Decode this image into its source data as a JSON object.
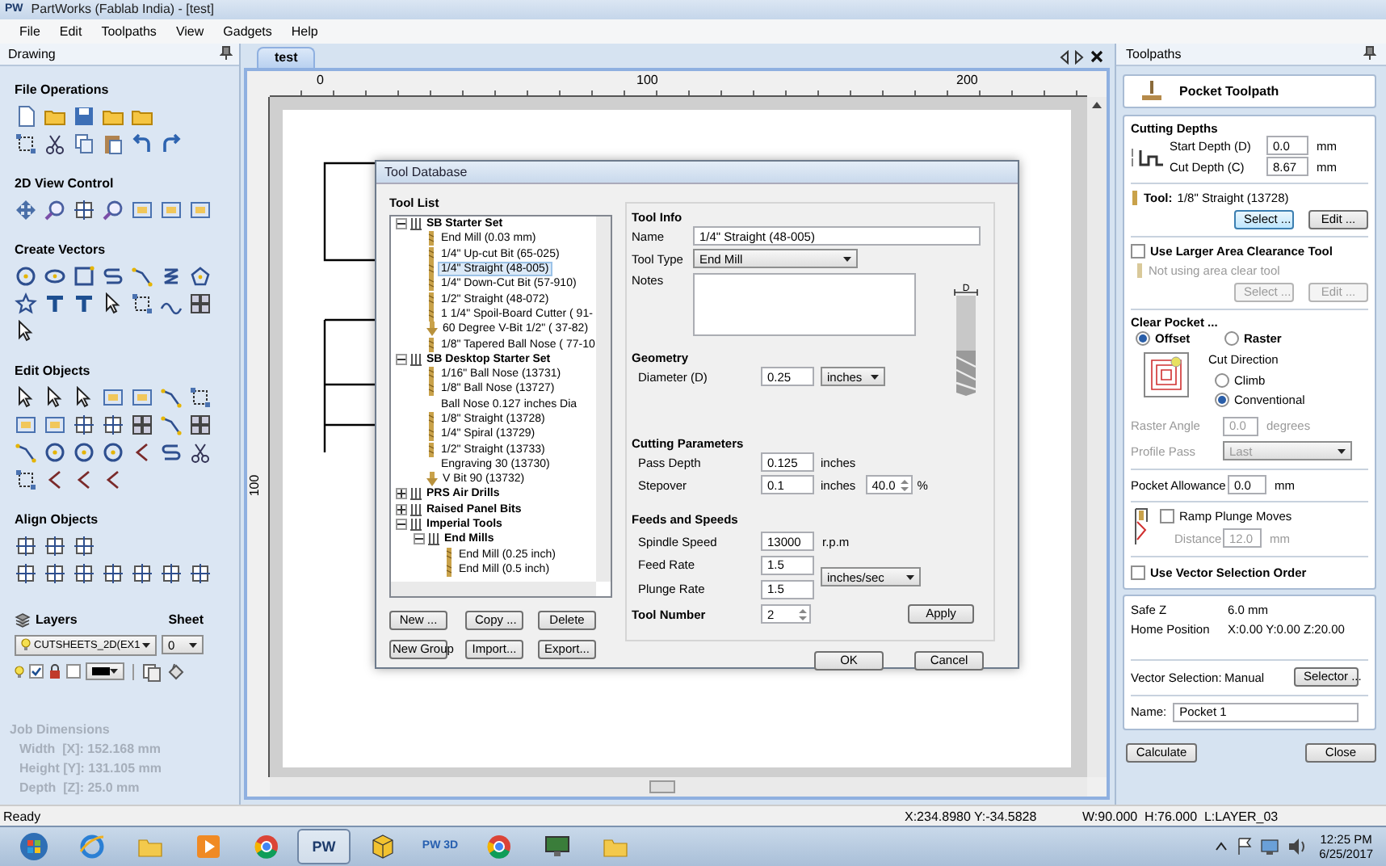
{
  "window": {
    "app_icon": "PW",
    "title": "PartWorks (Fablab India) - [test]"
  },
  "menu": [
    "File",
    "Edit",
    "Toolpaths",
    "View",
    "Gadgets",
    "Help"
  ],
  "drawing_panel": {
    "title": "Drawing",
    "sections": [
      {
        "title": "File Operations"
      },
      {
        "title": "2D View Control"
      },
      {
        "title": "Create Vectors"
      },
      {
        "title": "Edit Objects"
      },
      {
        "title": "Align Objects"
      }
    ],
    "layers": {
      "title": "Layers",
      "sheet_label": "Sheet",
      "layer": "CUTSHEETS_2D(EX1",
      "sheet": "0",
      "visible_checked": true,
      "locked_checked": false
    },
    "job_dimensions": {
      "title": "Job Dimensions",
      "lines": [
        "Width  [X]: 152.168 mm",
        "Height [Y]: 131.105 mm",
        "Depth  [Z]: 25.0 mm"
      ]
    }
  },
  "document_tab": {
    "label": "test",
    "selected": true
  },
  "ruler": {
    "top_ticks": [
      "0",
      "100",
      "200"
    ],
    "left_ticks": [
      "100"
    ]
  },
  "tool_database": {
    "title": "Tool Database",
    "list_title": "Tool List",
    "tree": [
      {
        "label": "SB Starter Set",
        "kind": "group",
        "expanded": true,
        "selected": false,
        "children": [
          {
            "label": "End Mill (0.03 mm)",
            "kind": "bit",
            "selected": false
          },
          {
            "label": "1/4\" Up-cut Bit (65-025)",
            "kind": "bit",
            "selected": false
          },
          {
            "label": "1/4\" Straight  (48-005)",
            "kind": "bit",
            "selected": true
          },
          {
            "label": "1/4\"  Down-Cut Bit (57-910)",
            "kind": "bit",
            "selected": false
          },
          {
            "label": "1/2\" Straight  (48-072)",
            "kind": "bit",
            "selected": false
          },
          {
            "label": "1 1/4\" Spoil-Board Cutter ( 91-",
            "kind": "bit",
            "selected": false
          },
          {
            "label": "60 Degree V-Bit 1/2\"  ( 37-82)",
            "kind": "vbit",
            "selected": false
          },
          {
            "label": "1/8\" Tapered Ball Nose ( 77-10",
            "kind": "bit",
            "selected": false
          }
        ]
      },
      {
        "label": "SB Desktop Starter Set",
        "kind": "group",
        "expanded": true,
        "selected": false,
        "children": [
          {
            "label": "1/16\" Ball Nose (13731)",
            "kind": "bit",
            "selected": false
          },
          {
            "label": "1/8\" Ball Nose (13727)",
            "kind": "bit",
            "selected": false
          },
          {
            "label": "Ball Nose 0.127 inches Dia",
            "kind": "plain",
            "selected": false
          },
          {
            "label": "1/8\" Straight (13728)",
            "kind": "bit",
            "selected": false
          },
          {
            "label": "1/4\" Spiral (13729)",
            "kind": "bit",
            "selected": false
          },
          {
            "label": "1/2\" Straight (13733)",
            "kind": "bit",
            "selected": false
          },
          {
            "label": "Engraving 30 (13730)",
            "kind": "plain",
            "selected": false
          },
          {
            "label": "V Bit 90 (13732)",
            "kind": "vbit",
            "selected": false
          }
        ]
      },
      {
        "label": "PRS Air Drills",
        "kind": "group",
        "expanded": false,
        "selected": false
      },
      {
        "label": "Raised Panel Bits",
        "kind": "group",
        "expanded": false,
        "selected": false
      },
      {
        "label": "Imperial Tools",
        "kind": "group",
        "expanded": true,
        "selected": false,
        "children": [
          {
            "label": "End Mills",
            "kind": "group",
            "expanded": true,
            "selected": false,
            "children": [
              {
                "label": "End Mill (0.25 inch)",
                "kind": "bit",
                "selected": false
              },
              {
                "label": "End Mill (0.5 inch)",
                "kind": "bit",
                "selected": false
              }
            ]
          }
        ]
      }
    ],
    "list_buttons": [
      "New ...",
      "Copy ...",
      "Delete",
      "New Group",
      "Import...",
      "Export..."
    ],
    "tool_info": {
      "title": "Tool Info",
      "name_label": "Name",
      "name": "1/4\" Straight  (48-005)",
      "type_label": "Tool Type",
      "type": "End Mill",
      "notes_label": "Notes"
    },
    "geometry": {
      "title": "Geometry",
      "diameter_label": "Diameter (D)",
      "diameter": "0.25",
      "unit": "inches",
      "diagram_label": "D"
    },
    "cutting": {
      "title": "Cutting Parameters",
      "pass_depth_label": "Pass Depth",
      "pass_depth": "0.125",
      "pass_depth_unit": "inches",
      "stepover_label": "Stepover",
      "stepover": "0.1",
      "stepover_unit": "inches",
      "stepover_percent": "40.0",
      "percent_sign": "%"
    },
    "feeds": {
      "title": "Feeds and Speeds",
      "spindle_label": "Spindle Speed",
      "spindle": "13000",
      "spindle_unit": "r.p.m",
      "feed_label": "Feed Rate",
      "feed": "1.5",
      "plunge_label": "Plunge Rate",
      "plunge": "1.5",
      "rate_unit": "inches/sec"
    },
    "tool_number": {
      "label": "Tool Number",
      "value": "2"
    },
    "apply": "Apply",
    "ok": "OK",
    "cancel": "Cancel"
  },
  "toolpaths_panel": {
    "title": "Toolpaths",
    "header": "Pocket Toolpath",
    "cutting_depths": {
      "title": "Cutting Depths",
      "start_label": "Start Depth (D)",
      "start_value": "0.0",
      "start_unit": "mm",
      "cut_label": "Cut Depth (C)",
      "cut_value": "8.67",
      "cut_unit": "mm"
    },
    "tool": {
      "label": "Tool:",
      "name": "1/8\" Straight (13728)",
      "select": "Select ...",
      "select_focused": true,
      "edit": "Edit ..."
    },
    "area_clearance": {
      "label": "Use Larger Area Clearance Tool",
      "checked": false,
      "tool_text": "Not using area clear tool",
      "select": "Select ...",
      "edit": "Edit ...",
      "disabled": true
    },
    "clear_pocket": {
      "title": "Clear Pocket ...",
      "modes": [
        {
          "label": "Offset",
          "selected": true
        },
        {
          "label": "Raster",
          "selected": false
        }
      ],
      "cut_direction": "Cut Direction",
      "directions": [
        {
          "label": "Climb",
          "selected": false
        },
        {
          "label": "Conventional",
          "selected": true
        }
      ],
      "raster_angle": {
        "label": "Raster Angle",
        "value": "0.0",
        "unit": "degrees",
        "disabled": true
      },
      "profile_pass": {
        "label": "Profile Pass",
        "value": "Last",
        "disabled": true
      }
    },
    "pocket_allowance": {
      "label": "Pocket Allowance",
      "value": "0.0",
      "unit": "mm"
    },
    "ramp": {
      "label": "Ramp Plunge Moves",
      "checked": false,
      "distance_label": "Distance",
      "distance": "12.0",
      "unit": "mm",
      "disabled": true
    },
    "vector_order": {
      "label": "Use Vector Selection Order",
      "checked": false
    },
    "summary": {
      "safe_z_label": "Safe Z",
      "safe_z": "6.0 mm",
      "home_label": "Home Position",
      "home": "X:0.00 Y:0.00 Z:20.00",
      "vector_label": "Vector Selection:",
      "vector_mode": "Manual",
      "selector": "Selector ...",
      "name_label": "Name:",
      "name": "Pocket 1"
    },
    "buttons": [
      "Calculate",
      "Close"
    ]
  },
  "status_bar": {
    "message": "Ready",
    "cursor": "X:234.8980 Y:-34.5828",
    "info": "W:90.000  H:76.000  L:LAYER_03"
  },
  "taskbar": {
    "apps": [
      {
        "kind": "start",
        "selected": false
      },
      {
        "kind": "ie",
        "selected": false
      },
      {
        "kind": "folder",
        "selected": false
      },
      {
        "kind": "media",
        "selected": false
      },
      {
        "kind": "chrome",
        "selected": false
      },
      {
        "kind": "pw",
        "label": "PW",
        "selected": true
      },
      {
        "kind": "cube",
        "selected": false
      },
      {
        "kind": "pw3d",
        "label": "PW 3D",
        "selected": false
      },
      {
        "kind": "chrome",
        "selected": false
      },
      {
        "kind": "monitor",
        "selected": false
      },
      {
        "kind": "folder",
        "selected": false
      }
    ],
    "clock": {
      "time": "12:25 PM",
      "date": "6/25/2017"
    }
  }
}
